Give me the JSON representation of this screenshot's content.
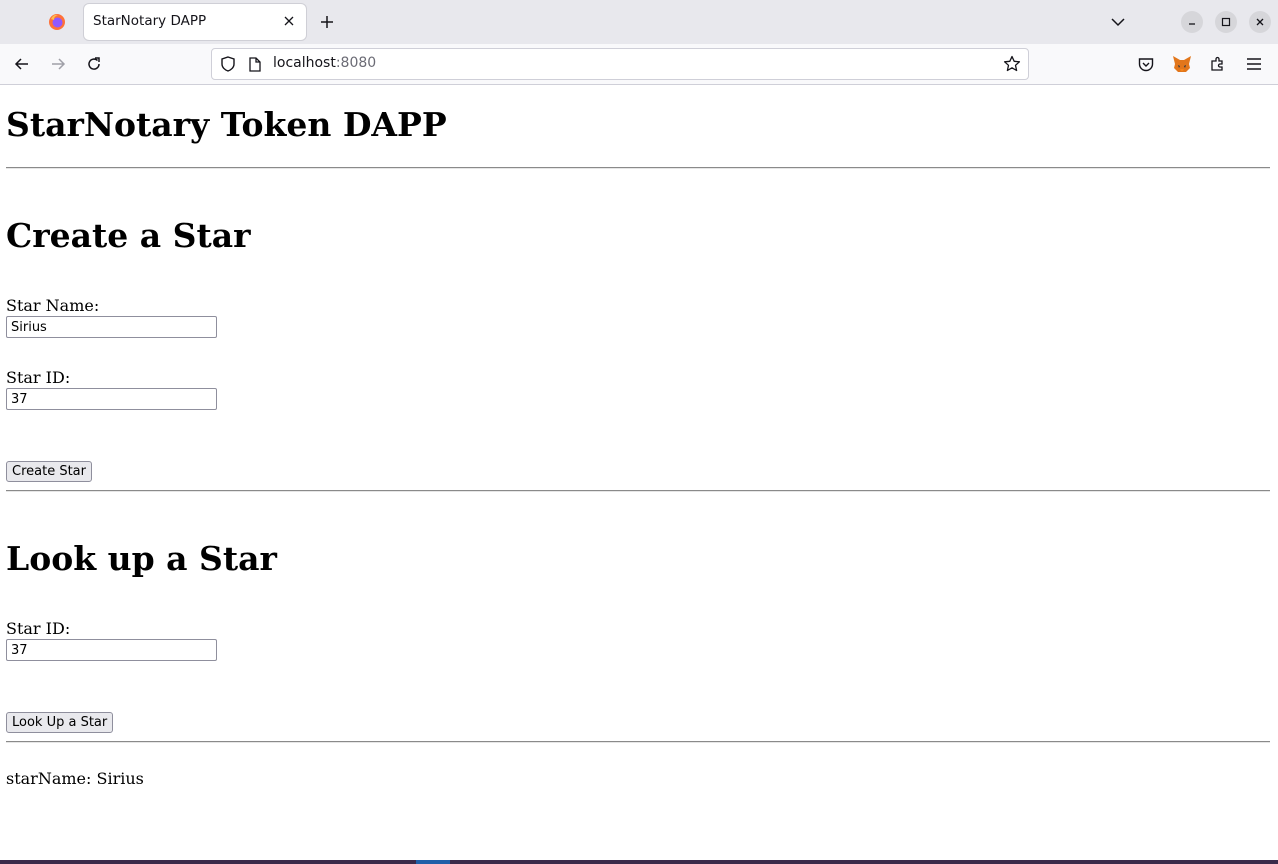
{
  "browser": {
    "tab": {
      "title": "StarNotary DAPP",
      "favicon": "firefox-icon"
    },
    "toolbar": {
      "url_host": "localhost",
      "url_port": ":8080"
    }
  },
  "page": {
    "title": "StarNotary Token DAPP",
    "create": {
      "heading": "Create a Star",
      "name_label": "Star Name:",
      "name_value": "Sirius",
      "id_label": "Star ID:",
      "id_value": "37",
      "button": "Create Star"
    },
    "lookup": {
      "heading": "Look up a Star",
      "id_label": "Star ID:",
      "id_value": "37",
      "button": "Look Up a Star"
    },
    "result": "starName: Sirius"
  },
  "colors": {
    "tabstrip_bg": "#e8e8ed",
    "toolbar_bg": "#f9f9fb",
    "metamask_orange": "#e2761b"
  }
}
